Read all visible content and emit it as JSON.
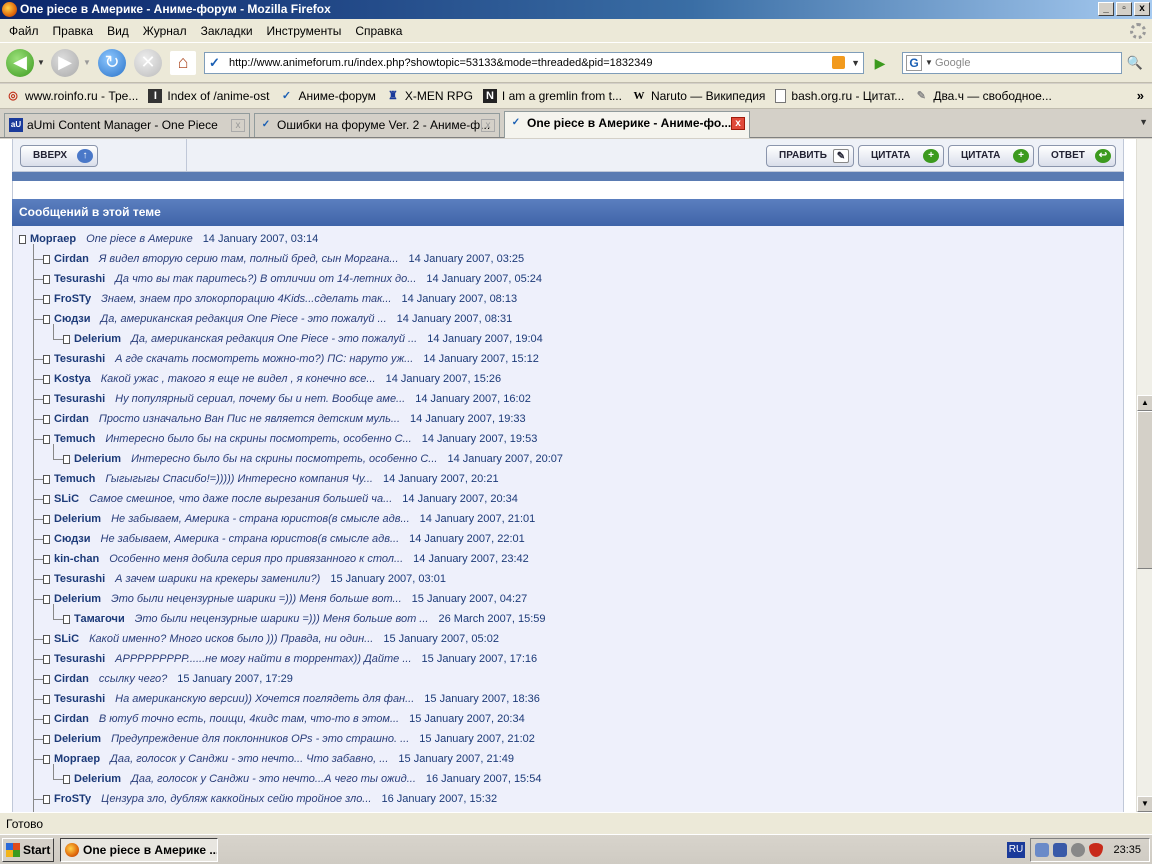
{
  "window": {
    "title": "One piece в Америке - Аниме-форум - Mozilla Firefox",
    "controls": [
      "_",
      "▫",
      "x"
    ]
  },
  "menu": [
    "Файл",
    "Правка",
    "Вид",
    "Журнал",
    "Закладки",
    "Инструменты",
    "Справка"
  ],
  "nav": {
    "url": "http://www.animeforum.ru/index.php?showtopic=53133&mode=threaded&pid=1832349",
    "search_placeholder": "Google"
  },
  "bookmarks": [
    {
      "label": "www.roinfo.ru - Тре...",
      "icon": "roinfo-icon"
    },
    {
      "label": "Index of /anime-ost",
      "icon": "index-icon"
    },
    {
      "label": "Аниме-форум",
      "icon": "animeforum-icon"
    },
    {
      "label": "X-MEN RPG",
      "icon": "xmen-icon"
    },
    {
      "label": "I am a gremlin from t...",
      "icon": "gremlin-icon"
    },
    {
      "label": "Naruto — Википедия",
      "icon": "wikipedia-icon"
    },
    {
      "label": "bash.org.ru - Цитат...",
      "icon": "page-icon"
    },
    {
      "label": "Два.ч — свободное...",
      "icon": "dvach-icon"
    }
  ],
  "tabs": [
    {
      "label": "aUmi Content Manager - One Piece",
      "icon_text": "aU",
      "active": false
    },
    {
      "label": "Ошибки на форуме Ver. 2 - Аниме-ф...",
      "icon_text": "",
      "active": false
    },
    {
      "label": "One piece в Америке - Аниме-фо...",
      "icon_text": "",
      "active": true
    }
  ],
  "forum": {
    "up_button": "ВВЕРХ",
    "edit_button": "ПРАВИТЬ",
    "quote_button_1": "ЦИТАТА",
    "quote_button_2": "ЦИТАТА",
    "reply_button": "ОТВЕТ",
    "topics_header": "Сообщений в этой теме",
    "posts": [
      {
        "author": "Моргаер",
        "snippet": "One piece в Америке",
        "date": "14 January 2007, 03:14",
        "depth": 0
      },
      {
        "author": "Cirdan",
        "snippet": "Я видел вторую серию там, полный бред, сын Моргана...",
        "date": "14 January 2007, 03:25",
        "depth": 1
      },
      {
        "author": "Tesurashi",
        "snippet": "Да что вы так паритесь?) В отличии от 14-летних до...",
        "date": "14 January 2007, 05:24",
        "depth": 1
      },
      {
        "author": "FroSTy",
        "snippet": "Знаем, знаем про злокорпорацию 4Kids...сделать так...",
        "date": "14 January 2007, 08:13",
        "depth": 1
      },
      {
        "author": "Сюдзи",
        "snippet": "Да, американская редакция One Piece - это пожалуй ...",
        "date": "14 January 2007, 08:31",
        "depth": 1
      },
      {
        "author": "Delerium",
        "snippet": "Да, американская редакция One Piece - это пожалуй ...",
        "date": "14 January 2007, 19:04",
        "depth": 2
      },
      {
        "author": "Tesurashi",
        "snippet": "А где скачать посмотреть можно-то?) ПС: наруто уж...",
        "date": "14 January 2007, 15:12",
        "depth": 1
      },
      {
        "author": "Kostya",
        "snippet": "Какой ужас , такого я еще не видел , я конечно все...",
        "date": "14 January 2007, 15:26",
        "depth": 1
      },
      {
        "author": "Tesurashi",
        "snippet": "Ну популярный сериал, почему бы и нет. Вообще аме...",
        "date": "14 January 2007, 16:02",
        "depth": 1
      },
      {
        "author": "Cirdan",
        "snippet": "Просто изначально Ван Пис не является детским муль...",
        "date": "14 January 2007, 19:33",
        "depth": 1
      },
      {
        "author": "Temuch",
        "snippet": "Интересно было бы на скрины посмотреть, особенно С...",
        "date": "14 January 2007, 19:53",
        "depth": 1
      },
      {
        "author": "Delerium",
        "snippet": "Интересно было бы на скрины посмотреть, особенно С...",
        "date": "14 January 2007, 20:07",
        "depth": 2
      },
      {
        "author": "Temuch",
        "snippet": "Гыгыгыгы Спасибо!=))))) Интересно компания Чу...",
        "date": "14 January 2007, 20:21",
        "depth": 1
      },
      {
        "author": "SLiC",
        "snippet": "Самое смешное, что даже после вырезания большей ча...",
        "date": "14 January 2007, 20:34",
        "depth": 1
      },
      {
        "author": "Delerium",
        "snippet": "Не забываем, Америка - страна юристов(в смысле адв...",
        "date": "14 January 2007, 21:01",
        "depth": 1
      },
      {
        "author": "Сюдзи",
        "snippet": "Не забываем, Америка - страна юристов(в смысле адв...",
        "date": "14 January 2007, 22:01",
        "depth": 1
      },
      {
        "author": "kin-chan",
        "snippet": "Особенно меня добила серия про привязанного к стол...",
        "date": "14 January 2007, 23:42",
        "depth": 1
      },
      {
        "author": "Tesurashi",
        "snippet": "А зачем шарики на крекеры заменили?)",
        "date": "15 January 2007, 03:01",
        "depth": 1
      },
      {
        "author": "Delerium",
        "snippet": "Это были нецензурные шарики =))) Меня больше вот...",
        "date": "15 January 2007, 04:27",
        "depth": 1
      },
      {
        "author": "Тамагочи",
        "snippet": "Это были нецензурные шарики =))) Меня больше вот ...",
        "date": "26 March 2007, 15:59",
        "depth": 2
      },
      {
        "author": "SLiC",
        "snippet": "Какой именно? Много исков было ))) Правда, ни один...",
        "date": "15 January 2007, 05:02",
        "depth": 1
      },
      {
        "author": "Tesurashi",
        "snippet": "АРРРРРРРРР......не могу найти в торрентах)) Дайте ...",
        "date": "15 January 2007, 17:16",
        "depth": 1
      },
      {
        "author": "Cirdan",
        "snippet": "ссылку чего?",
        "date": "15 January 2007, 17:29",
        "depth": 1
      },
      {
        "author": "Tesurashi",
        "snippet": "На американскую версии)) Хочется поглядеть для фан...",
        "date": "15 January 2007, 18:36",
        "depth": 1
      },
      {
        "author": "Cirdan",
        "snippet": "В ютуб точно есть, поищи, 4кидс там, что-то в этом...",
        "date": "15 January 2007, 20:34",
        "depth": 1
      },
      {
        "author": "Delerium",
        "snippet": "Предупреждение для поклонников OPs - это страшно. ...",
        "date": "15 January 2007, 21:02",
        "depth": 1
      },
      {
        "author": "Моргаер",
        "snippet": "Даа, голосок у Санджи - это нечто... Что забавно, ...",
        "date": "15 January 2007, 21:49",
        "depth": 1
      },
      {
        "author": "Delerium",
        "snippet": "Даа, голосок у Санджи - это нечто...А чего ты ожид...",
        "date": "16 January 2007, 15:54",
        "depth": 2
      },
      {
        "author": "FroSTy",
        "snippet": "Цензура зло, дубляж каккойных сейю тройное зло...",
        "date": "16 January 2007, 15:32",
        "depth": 1
      }
    ]
  },
  "status": "Готово",
  "taskbar": {
    "start": "Start",
    "item": "One piece в Америке ...",
    "lang": "RU",
    "clock": "23:35"
  }
}
